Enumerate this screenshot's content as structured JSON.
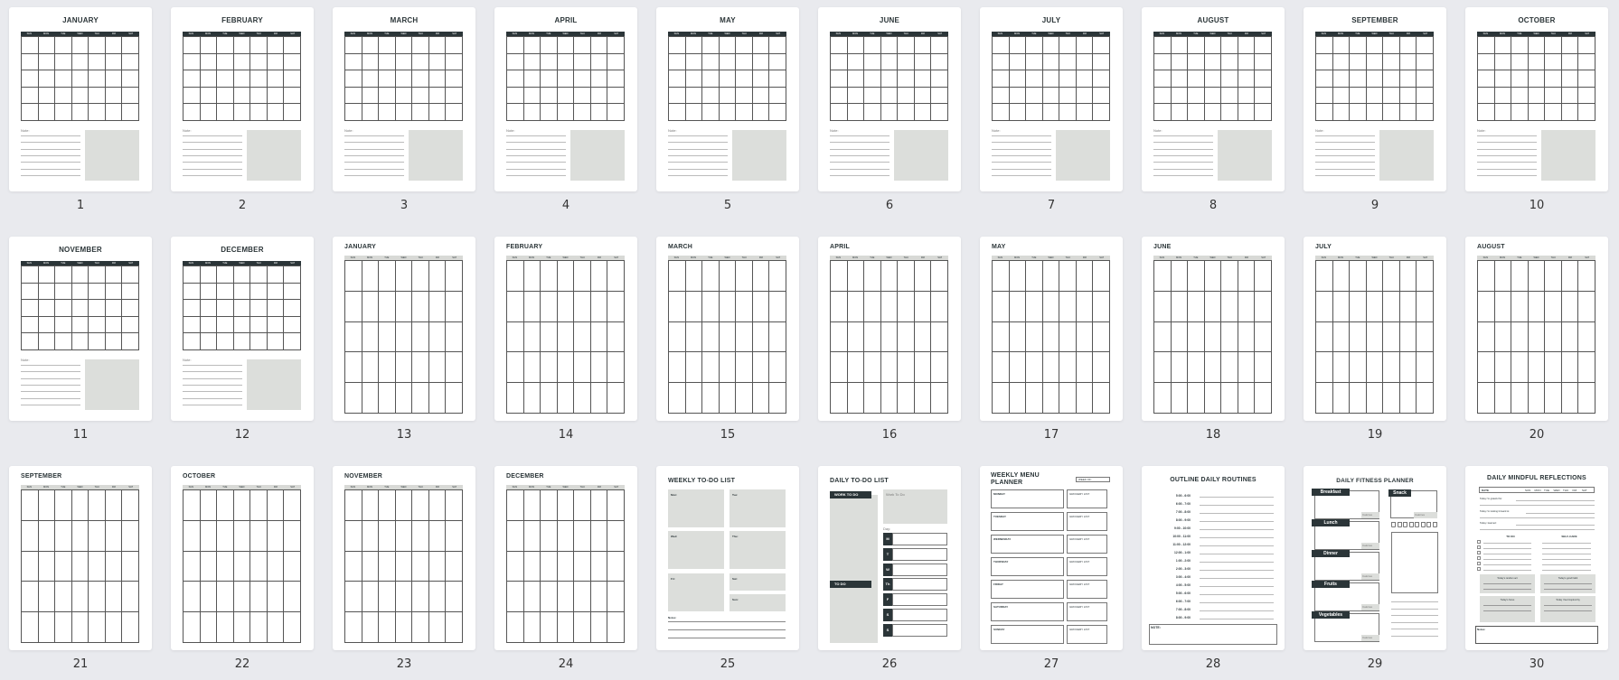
{
  "colors": {
    "background": "#e9eaee",
    "dark": "#2b3538",
    "gray_fill": "#dcdedb"
  },
  "weekdays": [
    "SUN",
    "MON",
    "TUE",
    "WED",
    "THU",
    "FRI",
    "SAT"
  ],
  "pages": [
    {
      "number": "1",
      "type": "month-notes",
      "title": "JANUARY",
      "notes_label": "Note:"
    },
    {
      "number": "2",
      "type": "month-notes",
      "title": "FEBRUARY",
      "notes_label": "Note:"
    },
    {
      "number": "3",
      "type": "month-notes",
      "title": "MARCH",
      "notes_label": "Note:"
    },
    {
      "number": "4",
      "type": "month-notes",
      "title": "APRIL",
      "notes_label": "Note:"
    },
    {
      "number": "5",
      "type": "month-notes",
      "title": "MAY",
      "notes_label": "Note:"
    },
    {
      "number": "6",
      "type": "month-notes",
      "title": "JUNE",
      "notes_label": "Note:"
    },
    {
      "number": "7",
      "type": "month-notes",
      "title": "JULY",
      "notes_label": "Note:"
    },
    {
      "number": "8",
      "type": "month-notes",
      "title": "AUGUST",
      "notes_label": "Note:"
    },
    {
      "number": "9",
      "type": "month-notes",
      "title": "SEPTEMBER",
      "notes_label": "Note:"
    },
    {
      "number": "10",
      "type": "month-notes",
      "title": "OCTOBER",
      "notes_label": "Note:"
    },
    {
      "number": "11",
      "type": "month-notes",
      "title": "NOVEMBER",
      "notes_label": "Note:"
    },
    {
      "number": "12",
      "type": "month-notes",
      "title": "DECEMBER",
      "notes_label": "Note:"
    },
    {
      "number": "13",
      "type": "month-grid",
      "title": "JANUARY"
    },
    {
      "number": "14",
      "type": "month-grid",
      "title": "FEBRUARY"
    },
    {
      "number": "15",
      "type": "month-grid",
      "title": "MARCH"
    },
    {
      "number": "16",
      "type": "month-grid",
      "title": "APRIL"
    },
    {
      "number": "17",
      "type": "month-grid",
      "title": "MAY"
    },
    {
      "number": "18",
      "type": "month-grid",
      "title": "JUNE"
    },
    {
      "number": "19",
      "type": "month-grid",
      "title": "JULY"
    },
    {
      "number": "20",
      "type": "month-grid",
      "title": "AUGUST"
    },
    {
      "number": "21",
      "type": "month-grid",
      "title": "SEPTEMBER"
    },
    {
      "number": "22",
      "type": "month-grid",
      "title": "OCTOBER"
    },
    {
      "number": "23",
      "type": "month-grid",
      "title": "NOVEMBER"
    },
    {
      "number": "24",
      "type": "month-grid",
      "title": "DECEMBER"
    },
    {
      "number": "25",
      "type": "weekly-todo",
      "title": "WEEKLY TO-DO LIST",
      "sections": [
        "Mon:",
        "Tue:",
        "Wed:",
        "Thu:",
        "Fri:",
        "Sat:",
        "Sun:"
      ],
      "notes_label": "Notes:"
    },
    {
      "number": "26",
      "type": "daily-todo",
      "title": "DAILY TO-DO LIST",
      "work_label": "WORK TO DO",
      "todo_label": "TO DO",
      "work_box_label": "Work To Do",
      "day_label": "Day:",
      "days": [
        "M",
        "T",
        "W",
        "Th",
        "F",
        "S",
        "S"
      ]
    },
    {
      "number": "27",
      "type": "menu-planner",
      "title_line1": "WEEKLY MENU",
      "title_line2": "PLANNER",
      "week_label": "WEEK OF:",
      "days": [
        "MONDAY",
        "TUESDAY",
        "WEDNESDAY",
        "THURSDAY",
        "FRIDAY",
        "SATURDAY",
        "SUNDAY"
      ],
      "grocery_label": "GROCERY LIST"
    },
    {
      "number": "28",
      "type": "routines",
      "title": "OUTLINE DAILY ROUTINES",
      "times": [
        "5:00 - 6:00",
        "6:00 - 7:00",
        "7:00 - 8:00",
        "8:00 - 9:00",
        "9:00 - 10:00",
        "10:00 - 11:00",
        "11:00 - 12:00",
        "12:00 - 1:00",
        "1:00 - 2:00",
        "2:00 - 3:00",
        "3:00 - 4:00",
        "4:00 - 5:00",
        "5:00 - 6:00",
        "6:00 - 7:00",
        "7:00 - 8:00",
        "8:00 - 9:00"
      ],
      "note_label": "NOTE:"
    },
    {
      "number": "29",
      "type": "fitness",
      "title": "DAILY FITNESS PLANNER",
      "meals": [
        "Breakfast",
        "Lunch",
        "Dinner",
        "Fruits",
        "Vegetables"
      ],
      "snack_label": "Snack",
      "calories_label": "Calories"
    },
    {
      "number": "30",
      "type": "mindful",
      "title": "DAILY MINDFUL REFLECTIONS",
      "date_label": "DATE",
      "prompts": [
        "Today I'm grateful for:",
        "Today I'm looking forward to:",
        "Today I learned:"
      ],
      "todo_label": "TO DO",
      "selfcare_label": "SELF-CARE",
      "boxes": [
        "Today's random act",
        "Today's good habit",
        "Today's focus",
        "Today I feel inspired by"
      ],
      "notes_label": "Notes:"
    }
  ]
}
